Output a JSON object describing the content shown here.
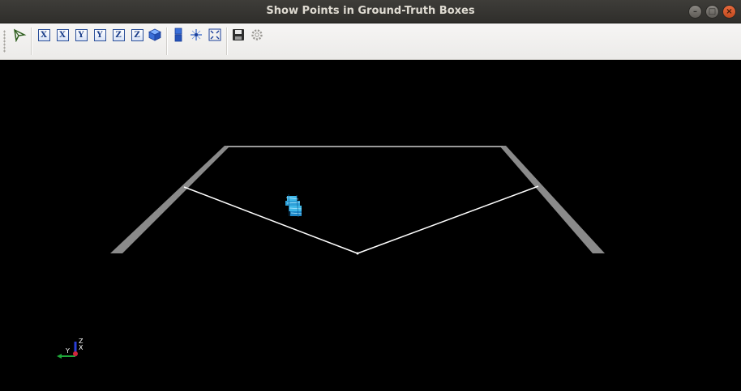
{
  "window": {
    "title": "Show Points in Ground-Truth Boxes",
    "minimize_glyph": "–",
    "maximize_glyph": "□",
    "close_glyph": "×"
  },
  "toolbar": {
    "items": [
      {
        "name": "select-tool-icon"
      },
      {
        "name": "view-x-front-icon",
        "glyph": "X"
      },
      {
        "name": "view-x-back-icon",
        "glyph": "X"
      },
      {
        "name": "view-y-front-icon",
        "glyph": "Y"
      },
      {
        "name": "view-y-back-icon",
        "glyph": "Y"
      },
      {
        "name": "view-z-front-icon",
        "glyph": "Z"
      },
      {
        "name": "view-z-back-icon",
        "glyph": "Z"
      },
      {
        "name": "isometric-cube-icon"
      },
      {
        "name": "perspective-toggle-icon"
      },
      {
        "name": "center-view-icon"
      },
      {
        "name": "fit-screen-icon"
      },
      {
        "name": "save-icon"
      },
      {
        "name": "settings-gear-icon"
      }
    ]
  },
  "viewport": {
    "background": "#000000",
    "ground_color": "#8a8a8a",
    "line_color": "#ffffff",
    "points_color": "#3fb8e8",
    "axes": {
      "x_label": "X",
      "y_label": "Y",
      "z_label": "Z",
      "x_color": "#d0263a",
      "y_color": "#1fa83a",
      "z_color": "#2a3fd8"
    }
  }
}
